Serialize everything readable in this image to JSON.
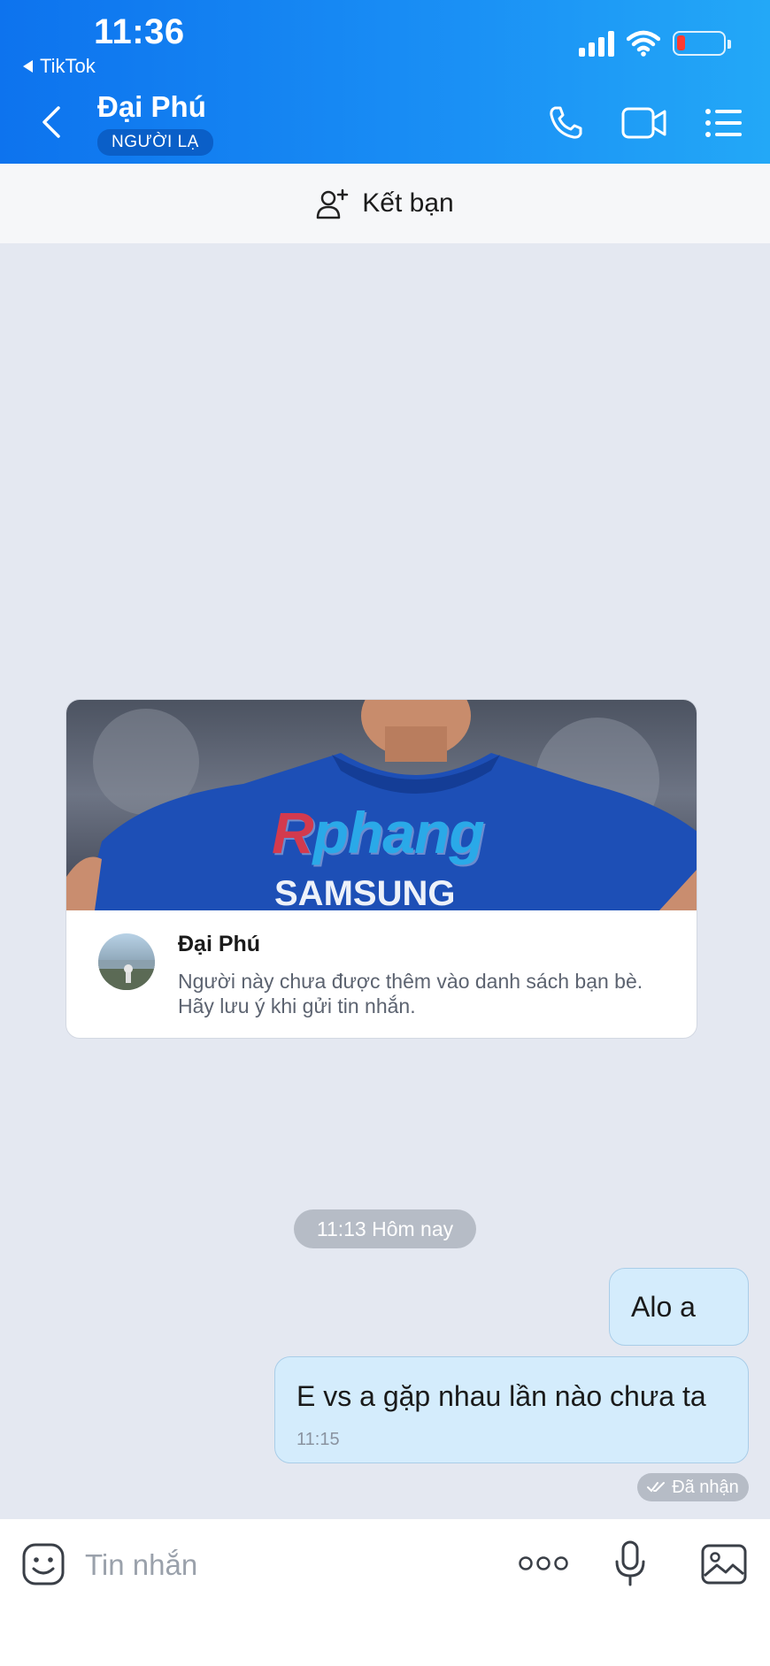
{
  "status": {
    "time": "11:36",
    "back_app": "TikTok"
  },
  "header": {
    "name": "Đại Phú",
    "badge": "NGƯỜI LẠ"
  },
  "friend_bar": {
    "label": "Kết bạn"
  },
  "card": {
    "watermark": {
      "r": "R",
      "rest": "phang"
    },
    "name": "Đại Phú",
    "description": "Người này chưa được thêm vào danh sách bạn bè. Hãy lưu ý khi gửi tin nhắn."
  },
  "conversation": {
    "time_divider": "11:13 Hôm nay",
    "messages": [
      {
        "text": "Alo a"
      },
      {
        "text": "E vs a gặp nhau lần nào chưa ta",
        "time": "11:15"
      }
    ],
    "status": "Đã nhận"
  },
  "composer": {
    "placeholder": "Tin nhắn"
  },
  "colors": {
    "header_start": "#0d73ee",
    "header_end": "#23a8f7",
    "bubble": "#d4ecfc",
    "background": "#e4e8f1"
  }
}
